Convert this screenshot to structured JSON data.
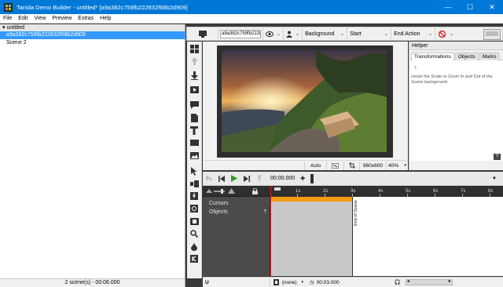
{
  "window": {
    "title": "Tanida Demo Builder - untitled* [a9a382c759fb222832f68b2d909]",
    "minimize": "—",
    "maximize": "☐",
    "close": "✕"
  },
  "menu": [
    "File",
    "Edit",
    "View",
    "Preview",
    "Extras",
    "Help"
  ],
  "project_tree": {
    "root": "untitled",
    "items": [
      {
        "label": "a9a382c759fb222832f68b2d909",
        "selected": true
      },
      {
        "label": "Scene 2",
        "selected": false
      }
    ],
    "status": "2 scene(s) - 00:06.000"
  },
  "toolbar": {
    "scene_name": "a9a382c759fb222832f68b2d909",
    "background_label": "Background",
    "start_label": "Start",
    "end_action_label": "End Action"
  },
  "stage_status": {
    "auto": "Auto",
    "resolution": "960x600",
    "zoom": "40%"
  },
  "helper": {
    "title": "Helper",
    "tabs": [
      "Transformations",
      "Objects",
      "Marks"
    ],
    "active_tab": "Transformations",
    "text": "resize the Scale or Zoom In and Out of the Scene background.",
    "help": "?"
  },
  "timeline": {
    "time": "00:00.000",
    "ruler": [
      "1s",
      "2s",
      "3s",
      "4s",
      "5s",
      "6s",
      "7s",
      "8s"
    ],
    "tracks": [
      "Cursors",
      "Objects"
    ],
    "end_scene": "End of Scene"
  },
  "bottom": {
    "audio": "(none)",
    "duration": "00:03.000"
  },
  "colors": {
    "titlebar": "#0078d7",
    "selection": "#3399ff",
    "track_orange": "#f39c12",
    "playhead": "#e02020"
  }
}
